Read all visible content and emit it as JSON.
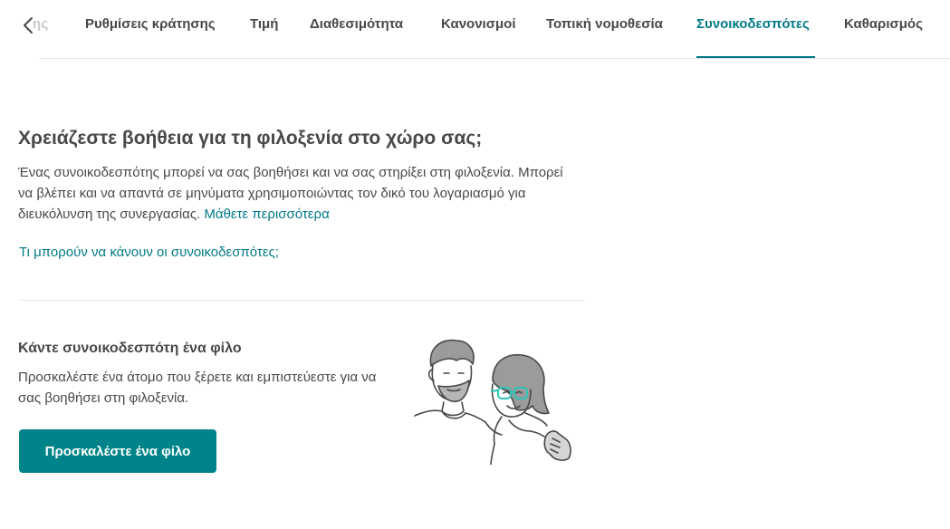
{
  "tabs": {
    "cut_off_label": "ης",
    "items": [
      {
        "label": "Ρυθμίσεις κράτησης"
      },
      {
        "label": "Τιμή"
      },
      {
        "label": "Διαθεσιμότητα"
      },
      {
        "label": "Κανονισμοί"
      },
      {
        "label": "Τοπική νομοθεσία"
      },
      {
        "label": "Συνοικοδεσπότες",
        "active": true
      },
      {
        "label": "Καθαρισμός"
      }
    ]
  },
  "intro": {
    "title": "Χρειάζεστε βοήθεια για τη φιλοξενία στο χώρο σας;",
    "body": "Ένας συνοικοδεσπότης μπορεί να σας βοηθήσει και να σας στηρίξει στη φιλοξενία. Μπορεί να βλέπει και να απαντά σε μηνύματα χρησιμοποιώντας τον δικό του λογαριασμό για διευκόλυνση της συνεργασίας. ",
    "learn_more": "Μάθετε περισσότερα",
    "what_link": "Τι μπορούν να κάνουν οι συνοικοδεσπότες;"
  },
  "invite": {
    "title": "Κάντε συνοικοδεσπότη ένα φίλο",
    "description": "Προσκαλέστε ένα άτομο που ξέρετε και εμπιστεύεστε για να σας βοηθήσει στη φιλοξενία.",
    "button_label": "Προσκαλέστε ένα φίλο"
  },
  "colors": {
    "accent": "#007a87",
    "button": "#008489",
    "text": "#484848",
    "glasses": "#2ec4b6"
  }
}
